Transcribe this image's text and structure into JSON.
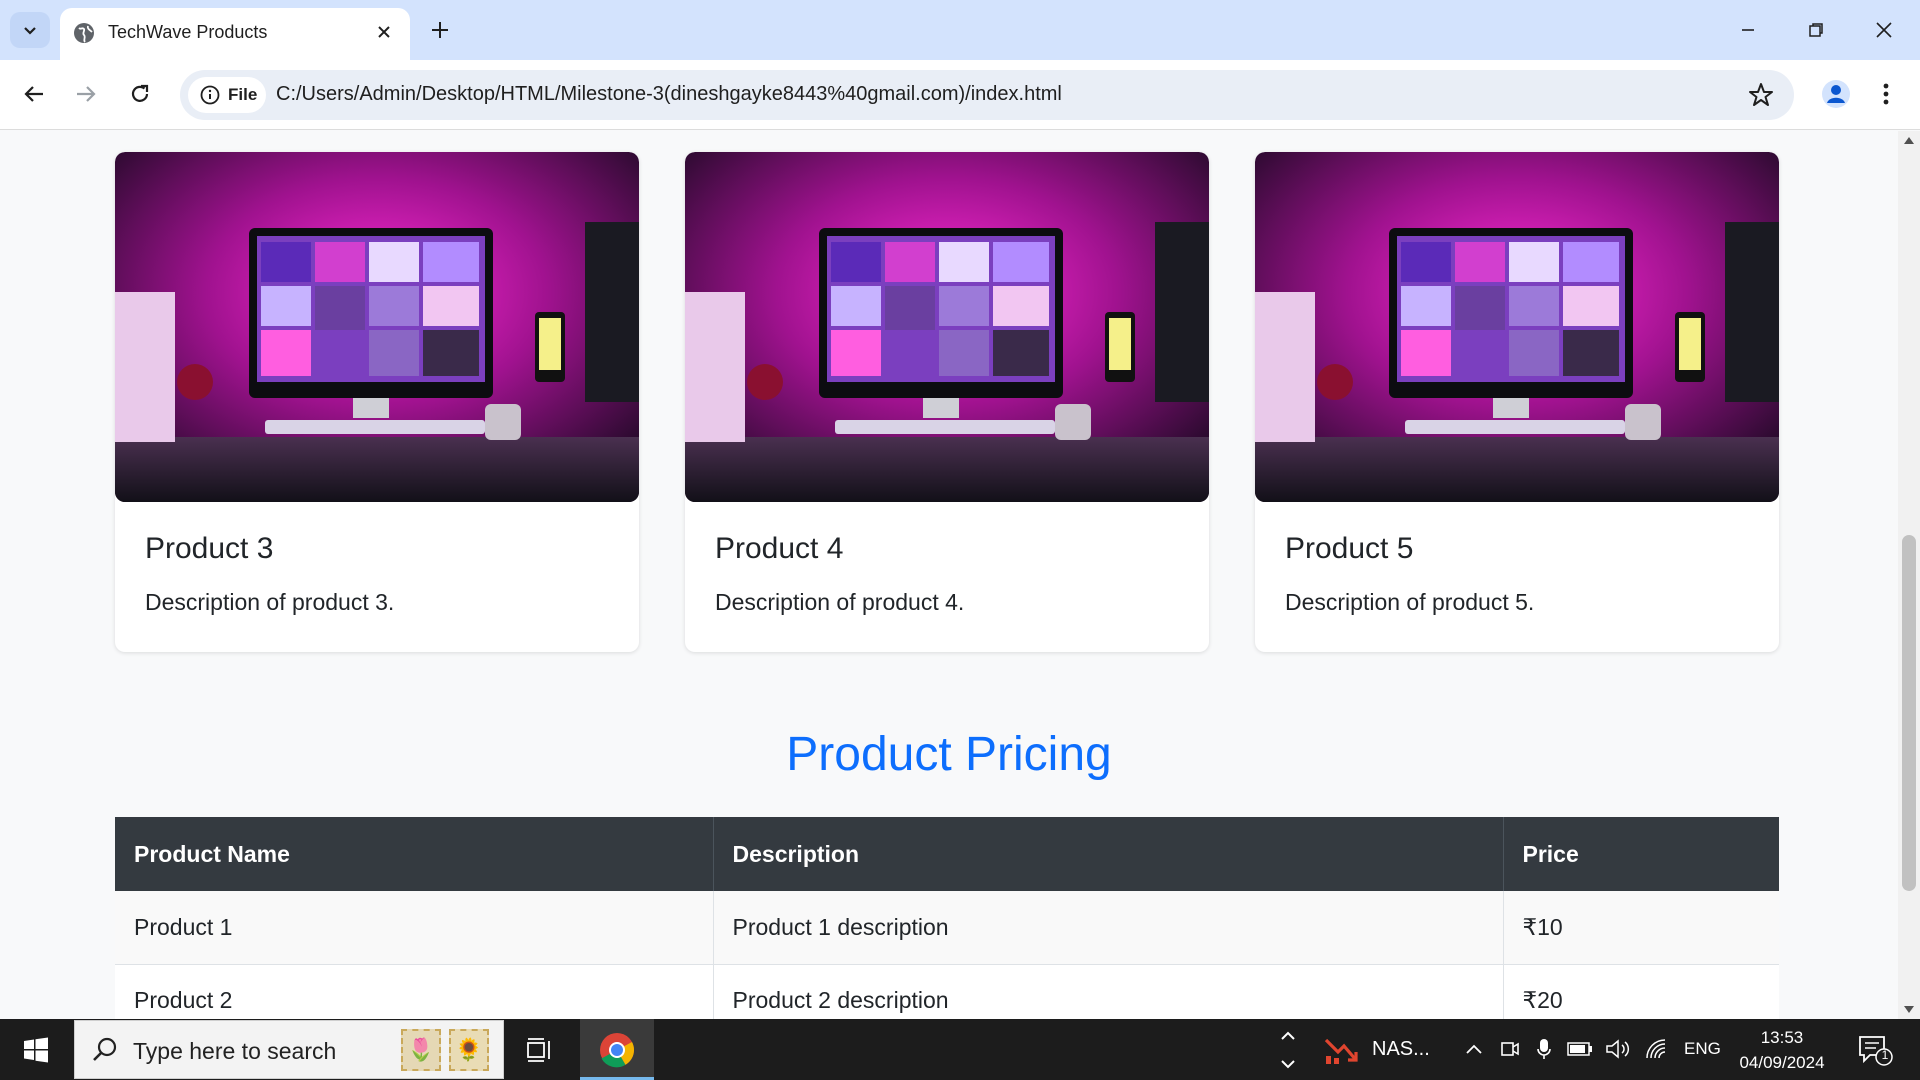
{
  "browser": {
    "tab_title": "TechWave Products",
    "url": "C:/Users/Admin/Desktop/HTML/Milestone-3(dineshgayke8443%40gmail.com)/index.html",
    "file_label": "File"
  },
  "products": [
    {
      "title": "Product 3",
      "description": "Description of product 3."
    },
    {
      "title": "Product 4",
      "description": "Description of product 4."
    },
    {
      "title": "Product 5",
      "description": "Description of product 5."
    }
  ],
  "pricing": {
    "heading": "Product Pricing",
    "columns": [
      "Product Name",
      "Description",
      "Price"
    ],
    "rows": [
      [
        "Product 1",
        "Product 1 description",
        "₹10"
      ],
      [
        "Product 2",
        "Product 2 description",
        "₹20"
      ]
    ]
  },
  "taskbar": {
    "search_placeholder": "Type here to search",
    "app_label": "NAS...",
    "language": "ENG",
    "time": "13:53",
    "date": "04/09/2024",
    "notification_count": "1"
  },
  "colors": {
    "accent": "#0d6efd",
    "table_header": "#343a40",
    "tab_strip": "#d3e3fd"
  }
}
